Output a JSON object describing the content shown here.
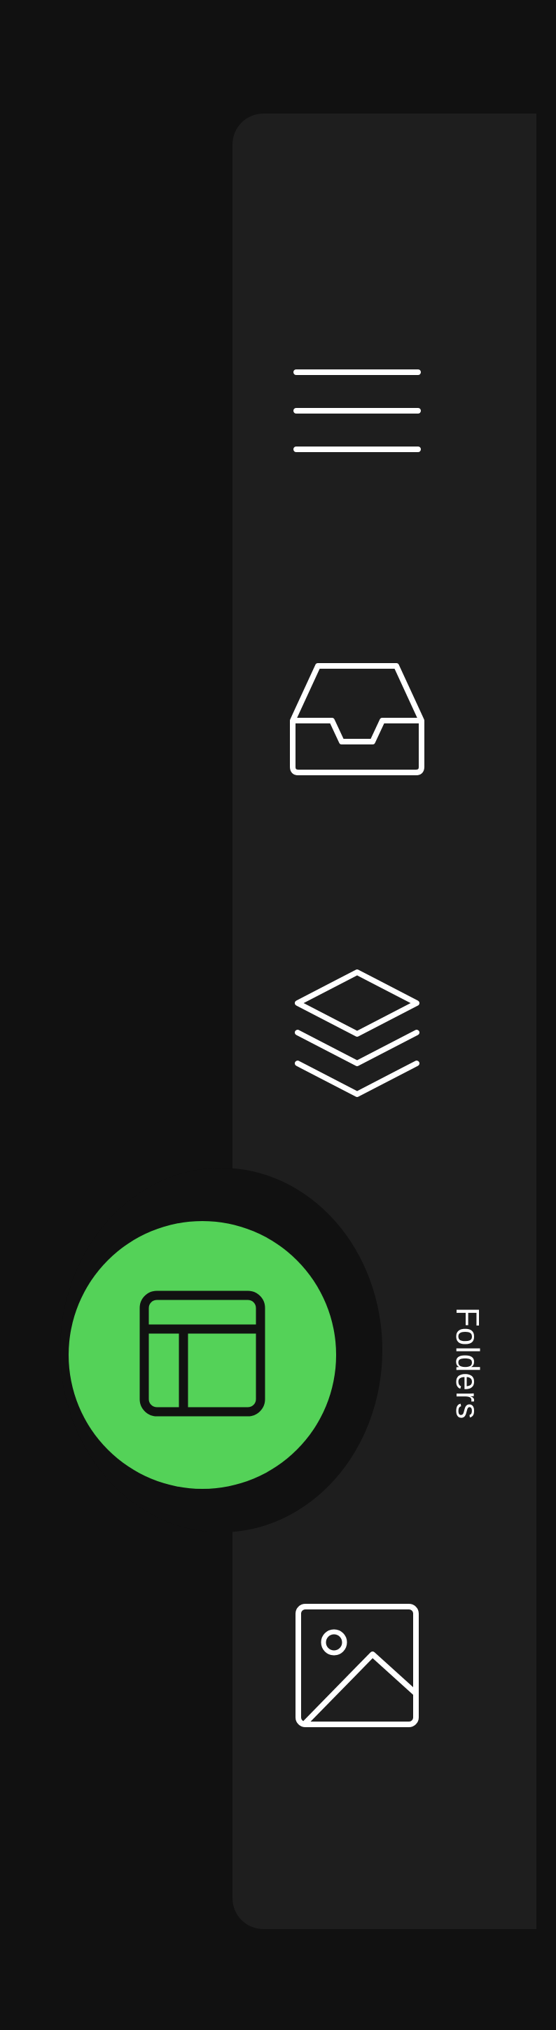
{
  "colors": {
    "background": "#111111",
    "rail": "#1e1e1e",
    "accent": "#54d258",
    "icon": "#ffffff",
    "active_icon": "#111111"
  },
  "nav": {
    "items": [
      {
        "icon": "menu-icon",
        "active": false
      },
      {
        "icon": "inbox-icon",
        "active": false
      },
      {
        "icon": "layers-icon",
        "active": false
      },
      {
        "icon": "layout-icon",
        "active": true,
        "label": "Folders"
      },
      {
        "icon": "image-icon",
        "active": false
      }
    ]
  }
}
